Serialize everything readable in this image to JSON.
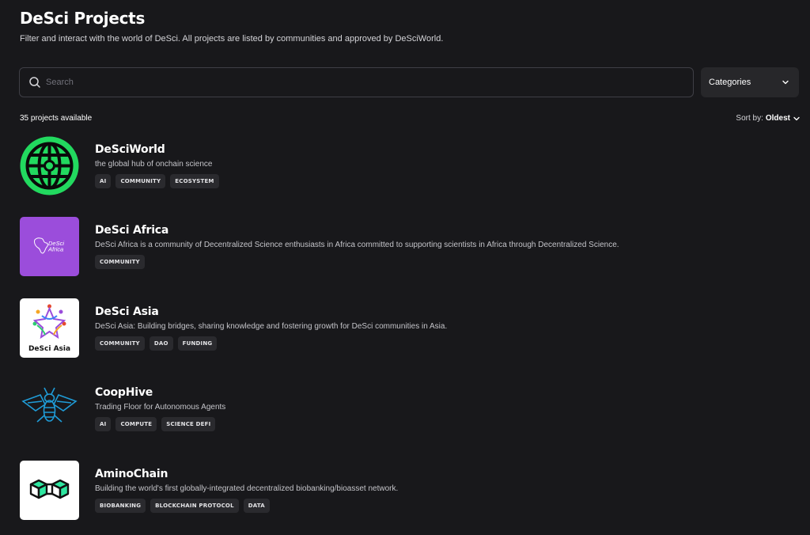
{
  "header": {
    "title": "DeSci Projects",
    "subtitle": "Filter and interact with the world of DeSci. All projects are listed by communities and approved by DeSciWorld."
  },
  "search": {
    "placeholder": "Search",
    "value": ""
  },
  "filters": {
    "categories_label": "Categories"
  },
  "results": {
    "count_text": "35 projects available",
    "sort_prefix": "Sort by:",
    "sort_value": "Oldest"
  },
  "projects": [
    {
      "name": "DeSciWorld",
      "description": "the global hub of onchain science",
      "tags": [
        "AI",
        "COMMUNITY",
        "ECOSYSTEM"
      ],
      "logo_icon": "globe-crosshair-icon",
      "logo_bg": "#18181b"
    },
    {
      "name": "DeSci Africa",
      "description": "DeSci Africa is a community of Decentralized Science enthusiasts in Africa committed to supporting scientists in Africa through Decentralized Science.",
      "tags": [
        "COMMUNITY"
      ],
      "logo_icon": "africa-map-icon",
      "logo_text": "DeSci\nAfrica",
      "logo_bg": "#9b4ddb"
    },
    {
      "name": "DeSci Asia",
      "description": "DeSci Asia: Building bridges, sharing knowledge and fostering growth for DeSci communities in Asia.",
      "tags": [
        "COMMUNITY",
        "DAO",
        "FUNDING"
      ],
      "logo_icon": "people-star-icon",
      "logo_text": "DeSci Asia",
      "logo_bg": "#ffffff"
    },
    {
      "name": "CoopHive",
      "description": "Trading Floor for Autonomous Agents",
      "tags": [
        "AI",
        "COMPUTE",
        "SCIENCE DEFI"
      ],
      "logo_icon": "bee-icon",
      "logo_bg": "#18181b"
    },
    {
      "name": "AminoChain",
      "description": "Building the world's first globally-integrated decentralized biobanking/bioasset network.",
      "tags": [
        "BIOBANKING",
        "BLOCKCHAIN PROTOCOL",
        "DATA"
      ],
      "logo_icon": "linked-cubes-icon",
      "logo_bg": "#ffffff"
    }
  ],
  "colors": {
    "background": "#18181b",
    "accent_green": "#22d95f",
    "africa_purple": "#9b4ddb",
    "coophive_blue": "#1f9bd6",
    "amino_green": "#2ee6a0"
  }
}
